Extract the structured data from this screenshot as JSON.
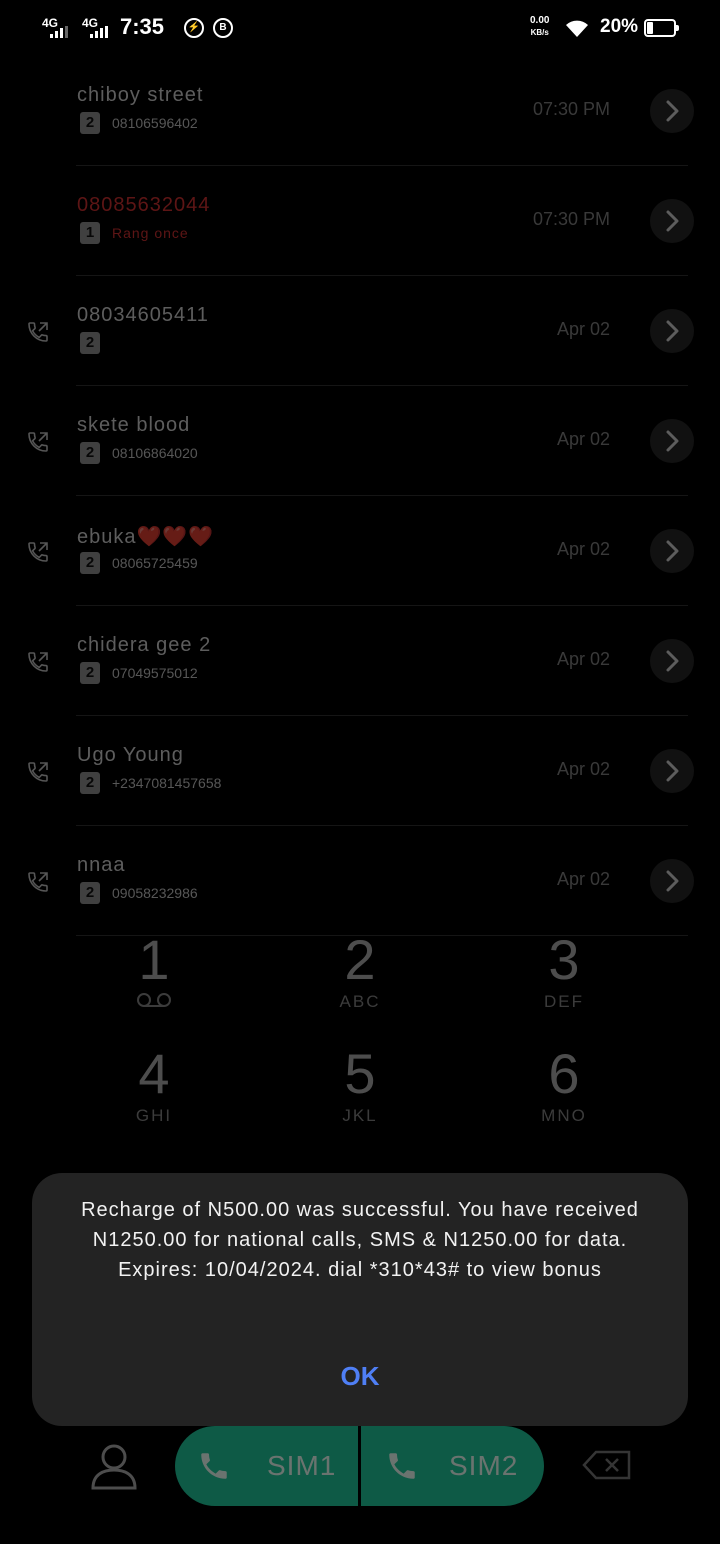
{
  "status_bar": {
    "network1": "4G",
    "network2": "4G",
    "time": "7:35",
    "speed_value": "0.00",
    "speed_unit": "KB/s",
    "battery": "20%",
    "battery_level": 0.2
  },
  "calls": [
    {
      "name": "chiboy street",
      "sim": "2",
      "detail": "08106596402",
      "time": "07:30 PM",
      "missed": false,
      "icon": ""
    },
    {
      "name": "08085632044",
      "sim": "1",
      "detail": "Rang once",
      "time": "07:30 PM",
      "missed": true,
      "icon": ""
    },
    {
      "name": "08034605411",
      "sim": "2",
      "detail": "",
      "time": "Apr 02",
      "missed": false,
      "icon": "outgoing-call-icon"
    },
    {
      "name": "skete blood",
      "sim": "2",
      "detail": "08106864020",
      "time": "Apr 02",
      "missed": false,
      "icon": "outgoing-call-icon"
    },
    {
      "name": "ebuka❤️❤️❤️",
      "sim": "2",
      "detail": "08065725459",
      "time": "Apr 02",
      "missed": false,
      "icon": "outgoing-call-icon"
    },
    {
      "name": "chidera gee 2",
      "sim": "2",
      "detail": "07049575012",
      "time": "Apr 02",
      "missed": false,
      "icon": "outgoing-call-icon"
    },
    {
      "name": "Ugo Young",
      "sim": "2",
      "detail": "+2347081457658",
      "time": "Apr 02",
      "missed": false,
      "icon": "outgoing-call-icon"
    },
    {
      "name": "nnaa",
      "sim": "2",
      "detail": "09058232986",
      "time": "Apr 02",
      "missed": false,
      "icon": "outgoing-call-icon"
    }
  ],
  "dialpad": [
    {
      "digit": "1",
      "letters": ""
    },
    {
      "digit": "2",
      "letters": "ABC"
    },
    {
      "digit": "3",
      "letters": "DEF"
    },
    {
      "digit": "4",
      "letters": "GHI"
    },
    {
      "digit": "5",
      "letters": "JKL"
    },
    {
      "digit": "6",
      "letters": "MNO"
    }
  ],
  "dialog": {
    "message": "Recharge of  N500.00 was successful. You have received N1250.00 for national calls, SMS & N1250.00 for data. Expires: 10/04/2024. dial *310*43# to view bonus",
    "ok_label": "OK"
  },
  "bottom_bar": {
    "sim1_label": "SIM1",
    "sim2_label": "SIM2"
  },
  "colors": {
    "accent_green": "#1fc79b",
    "missed_red": "#d33333",
    "ok_blue": "#4f7ff5"
  }
}
